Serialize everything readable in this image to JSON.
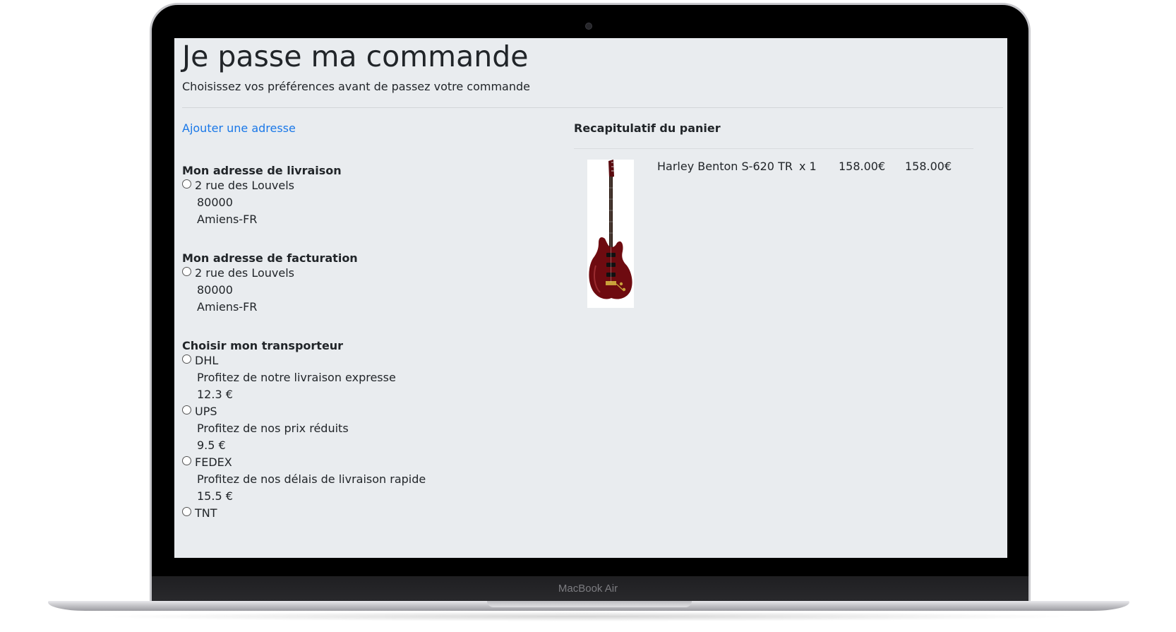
{
  "device": {
    "brand_label": "MacBook Air"
  },
  "page": {
    "title": "Je passe ma commande",
    "subtitle": "Choisissez vos préférences avant de passez votre commande",
    "add_address_link": "Ajouter une adresse"
  },
  "delivery": {
    "title": "Mon adresse de livraison",
    "address": {
      "street": "2 rue des Louvels",
      "postal_code": "80000",
      "city": "Amiens-FR"
    }
  },
  "billing": {
    "title": "Mon adresse de facturation",
    "address": {
      "street": "2 rue des Louvels",
      "postal_code": "80000",
      "city": "Amiens-FR"
    }
  },
  "carriers": {
    "title": "Choisir mon transporteur",
    "items": [
      {
        "name": "DHL",
        "description": "Profitez de notre livraison expresse",
        "price": "12.3 €"
      },
      {
        "name": "UPS",
        "description": "Profitez de nos prix réduits",
        "price": "9.5 €"
      },
      {
        "name": "FEDEX",
        "description": "Profitez de nos délais de livraison rapide",
        "price": "15.5 €"
      },
      {
        "name": "TNT",
        "description": "",
        "price": ""
      }
    ]
  },
  "cart": {
    "title": "Recapitulatif du panier",
    "items": [
      {
        "product_name": "Harley Benton S-620 TR",
        "quantity": "x 1",
        "unit_price": "158.00€",
        "total_price": "158.00€"
      }
    ]
  },
  "colors": {
    "page_background": "#e9ecef",
    "link": "#1a78e8",
    "text": "#212529",
    "guitar_body": "#6e0b10"
  }
}
